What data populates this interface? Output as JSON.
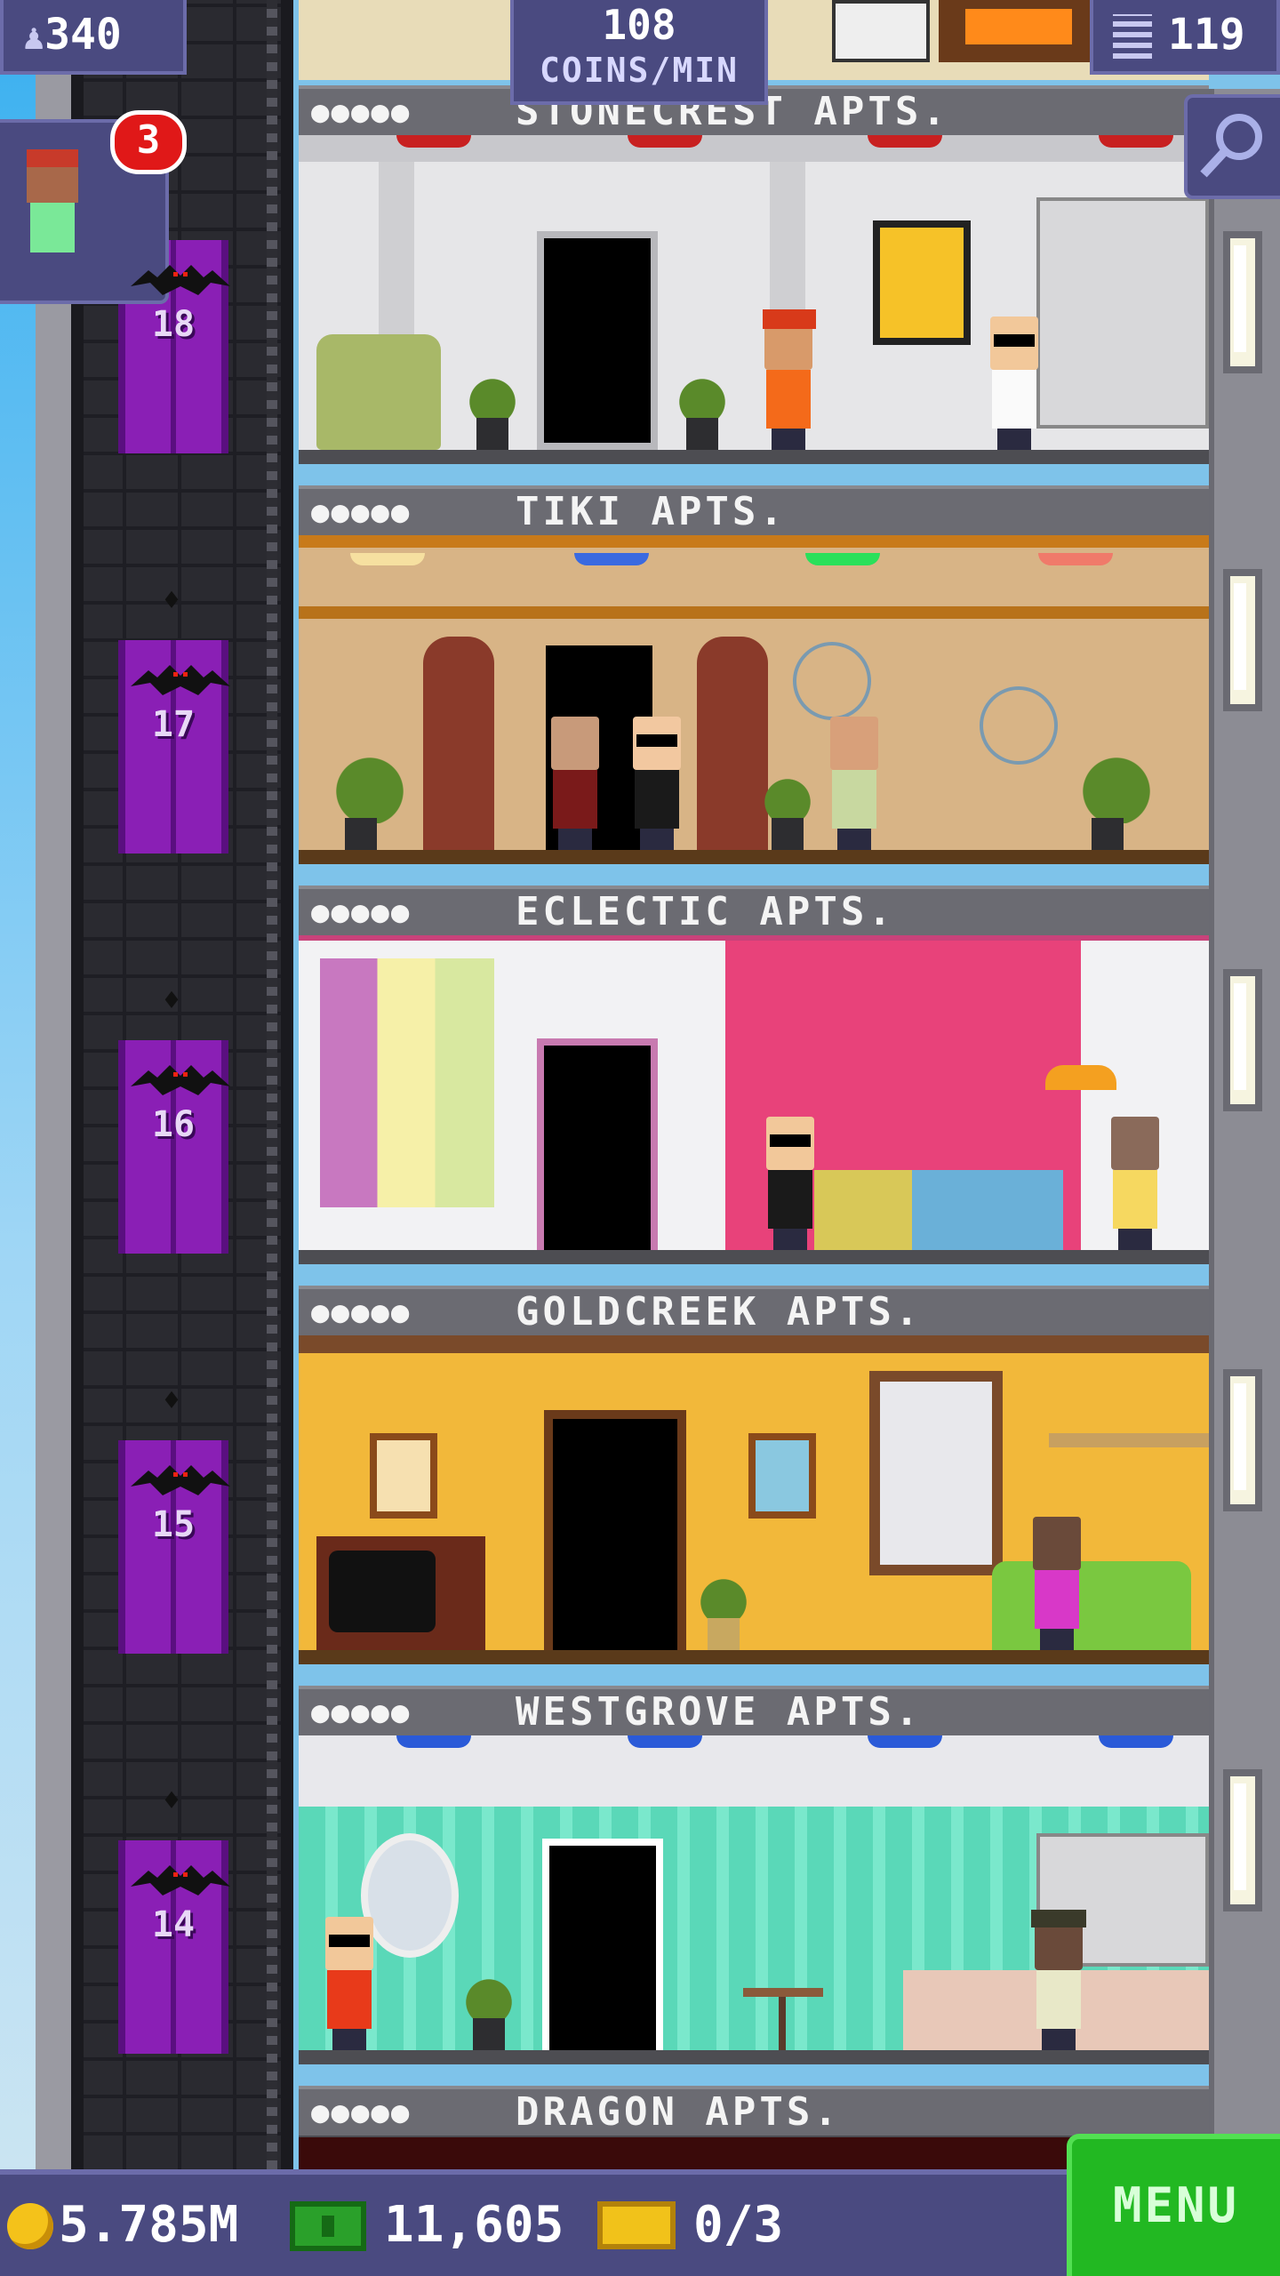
{
  "hud": {
    "population": "340",
    "rate_value": "108",
    "rate_unit": "COINS/MIN",
    "floors": "119",
    "visitor_badge": "3"
  },
  "floors": [
    {
      "number": "18",
      "label_above": "STONECREST APTS."
    },
    {
      "number": "17",
      "label_above": "TIKI APTS."
    },
    {
      "number": "16",
      "label_above": "ECLECTIC APTS."
    },
    {
      "number": "15",
      "label_above": "GOLDCREEK APTS."
    },
    {
      "number": "14",
      "label_above": "WESTGROVE APTS."
    }
  ],
  "bottom_floor_label": "DRAGON APTS.",
  "resident_dots": "●●●●●",
  "currency": {
    "coins": "5.785M",
    "bux": "11,605",
    "tickets": "0/3"
  },
  "menu_label": "MENU",
  "icons": [
    "person-icon",
    "building-icon",
    "search-icon",
    "coin-icon",
    "bux-icon",
    "ticket-icon",
    "bat-icon"
  ]
}
